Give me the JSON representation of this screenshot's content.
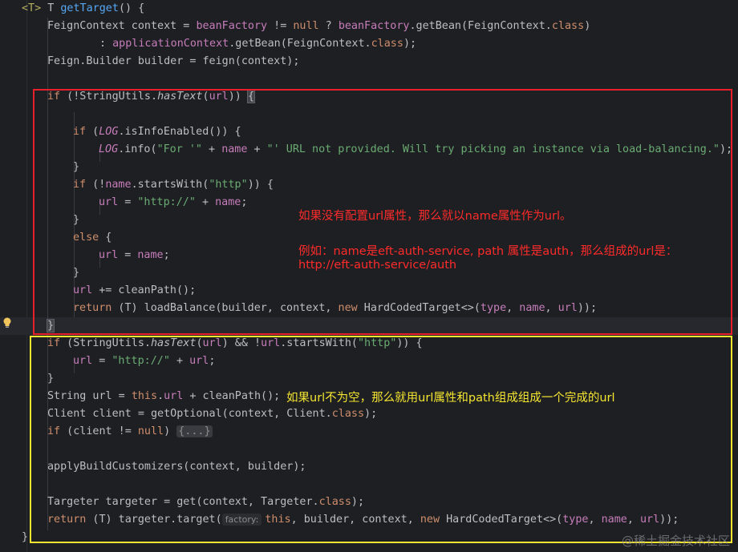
{
  "code": {
    "l0_gen": "<T>",
    "l0_a": " T ",
    "l0_fn": "getTarget",
    "l0_b": "() {",
    "l1_a": "FeignContext context = ",
    "l1_field": "beanFactory",
    "l1_b": " != ",
    "l1_null": "null",
    "l1_c": " ? ",
    "l1_field2": "beanFactory",
    "l1_d": ".getBean(FeignContext.",
    "l1_cls": "class",
    "l1_e": ")",
    "l2_a": ": ",
    "l2_field": "applicationContext",
    "l2_b": ".getBean(FeignContext.",
    "l2_cls": "class",
    "l2_c": ");",
    "l3": "Feign.Builder builder = feign(context);",
    "l5_if": "if",
    "l5_a": " (!StringUtils.",
    "l5_m": "hasText",
    "l5_b": "(",
    "l5_url": "url",
    "l5_c": ")) ",
    "l5_d": "{",
    "l7_if": "if",
    "l7_a": " (",
    "l7_log": "LOG",
    "l7_b": ".isInfoEnabled()) {",
    "l8_log": "LOG",
    "l8_a": ".info(",
    "l8_s1": "\"For '\"",
    "l8_b": " + ",
    "l8_name": "name",
    "l8_c": " + ",
    "l8_s2": "\"' URL not provided. Will try picking an instance via load-balancing.\"",
    "l8_d": ");",
    "l9": "}",
    "l10_if": "if",
    "l10_a": " (!",
    "l10_name": "name",
    "l10_b": ".startsWith(",
    "l10_s": "\"http\"",
    "l10_c": ")) {",
    "l11_url": "url",
    "l11_a": " = ",
    "l11_s": "\"http://\"",
    "l11_b": " + ",
    "l11_name": "name",
    "l11_c": ";",
    "l12": "}",
    "l13_else": "else",
    "l13_a": " {",
    "l14_url": "url",
    "l14_a": " = ",
    "l14_name": "name",
    "l14_b": ";",
    "l15": "}",
    "l16_url": "url",
    "l16_a": " += cleanPath();",
    "l17_ret": "return",
    "l17_a": " (T) loadBalance(builder, context, ",
    "l17_new": "new",
    "l17_b": " HardCodedTarget<>(",
    "l17_type": "type",
    "l17_c": ", ",
    "l17_name": "name",
    "l17_d": ", ",
    "l17_url": "url",
    "l17_e": "));",
    "l18": "}",
    "l19_if": "if",
    "l19_a": " (StringUtils.",
    "l19_m": "hasText",
    "l19_b": "(",
    "l19_url": "url",
    "l19_c": ") && !",
    "l19_url2": "url",
    "l19_d": ".startsWith(",
    "l19_s": "\"http\"",
    "l19_e": ")) {",
    "l20_url": "url",
    "l20_a": " = ",
    "l20_s": "\"http://\"",
    "l20_b": " + ",
    "l20_url2": "url",
    "l20_c": ";",
    "l21": "}",
    "l22_a": "String url = ",
    "l22_this": "this",
    "l22_b": ".",
    "l22_url": "url",
    "l22_c": " + cleanPath();",
    "l23_a": "Client client = getOptional(context, Client.",
    "l23_cls": "class",
    "l23_b": ");",
    "l24_if": "if",
    "l24_a": " (client != ",
    "l24_null": "null",
    "l24_b": ") ",
    "l24_fold": "{...}",
    "l26": "applyBuildCustomizers(context, builder);",
    "l28_a": "Targeter targeter = get(context, Targeter.",
    "l28_cls": "class",
    "l28_b": ");",
    "l29_ret": "return",
    "l29_a": " (T) targeter.target(",
    "l29_hint": "factory:",
    "l29_this": "this",
    "l29_b": ", builder, context, ",
    "l29_new": "new",
    "l29_c": " HardCodedTarget<>(",
    "l29_type": "type",
    "l29_d": ", ",
    "l29_name": "name",
    "l29_e": ", ",
    "l29_url": "url",
    "l29_f": "));",
    "l30": "}"
  },
  "annotations": {
    "red_1": "如果没有配置url属性，那么就以name属性作为url。",
    "red_2": "例如：name是eft-auth-service, path 属性是auth，那么组成的url是：",
    "red_3": "http://eft-auth-service/auth",
    "yellow_1": "如果url不为空，那么就用url属性和path组成组成一个完成的url"
  },
  "watermark": "@稀土掘金技术社区",
  "colors": {
    "background": "#1e1f22",
    "keyword": "#cf8e6d",
    "string": "#6aab73",
    "field": "#c77dbb",
    "function": "#56a8f5",
    "red_box": "#e8202b",
    "yellow_box": "#f4e531"
  },
  "icons": {
    "gutter": "lightbulb-icon"
  }
}
